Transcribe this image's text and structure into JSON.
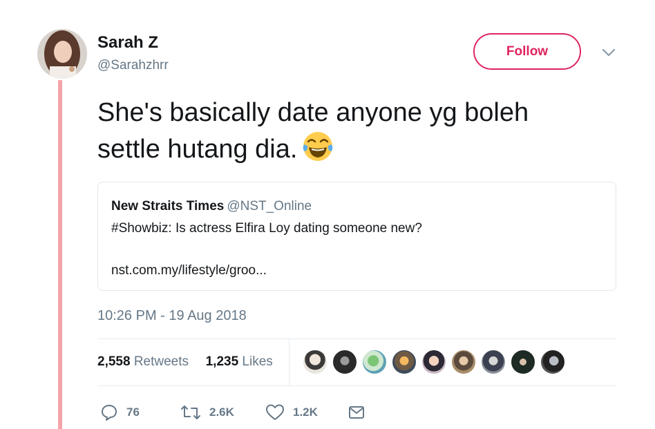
{
  "author": {
    "name": "Sarah Z",
    "handle": "@Sarahzhrr"
  },
  "follow_label": "Follow",
  "tweet_text": "She's basically date anyone yg boleh settle hutang dia.",
  "emoji_icon": "face-with-tears-of-joy",
  "quoted": {
    "name": "New Straits Times",
    "handle": "@NST_Online",
    "text": "#Showbiz: Is actress Elfira Loy dating someone new?",
    "link": "nst.com.my/lifestyle/groo..."
  },
  "timestamp": "10:26 PM - 19 Aug 2018",
  "stats": {
    "retweets_count": "2,558",
    "retweets_label": "Retweets",
    "likes_count": "1,235",
    "likes_label": "Likes"
  },
  "actions": {
    "replies": "76",
    "retweets": "2.6K",
    "likes": "1.2K"
  },
  "colors": {
    "accent": "#e0245e",
    "thread_line": "#f4a4a8",
    "muted": "#657786",
    "text": "#14171a"
  }
}
